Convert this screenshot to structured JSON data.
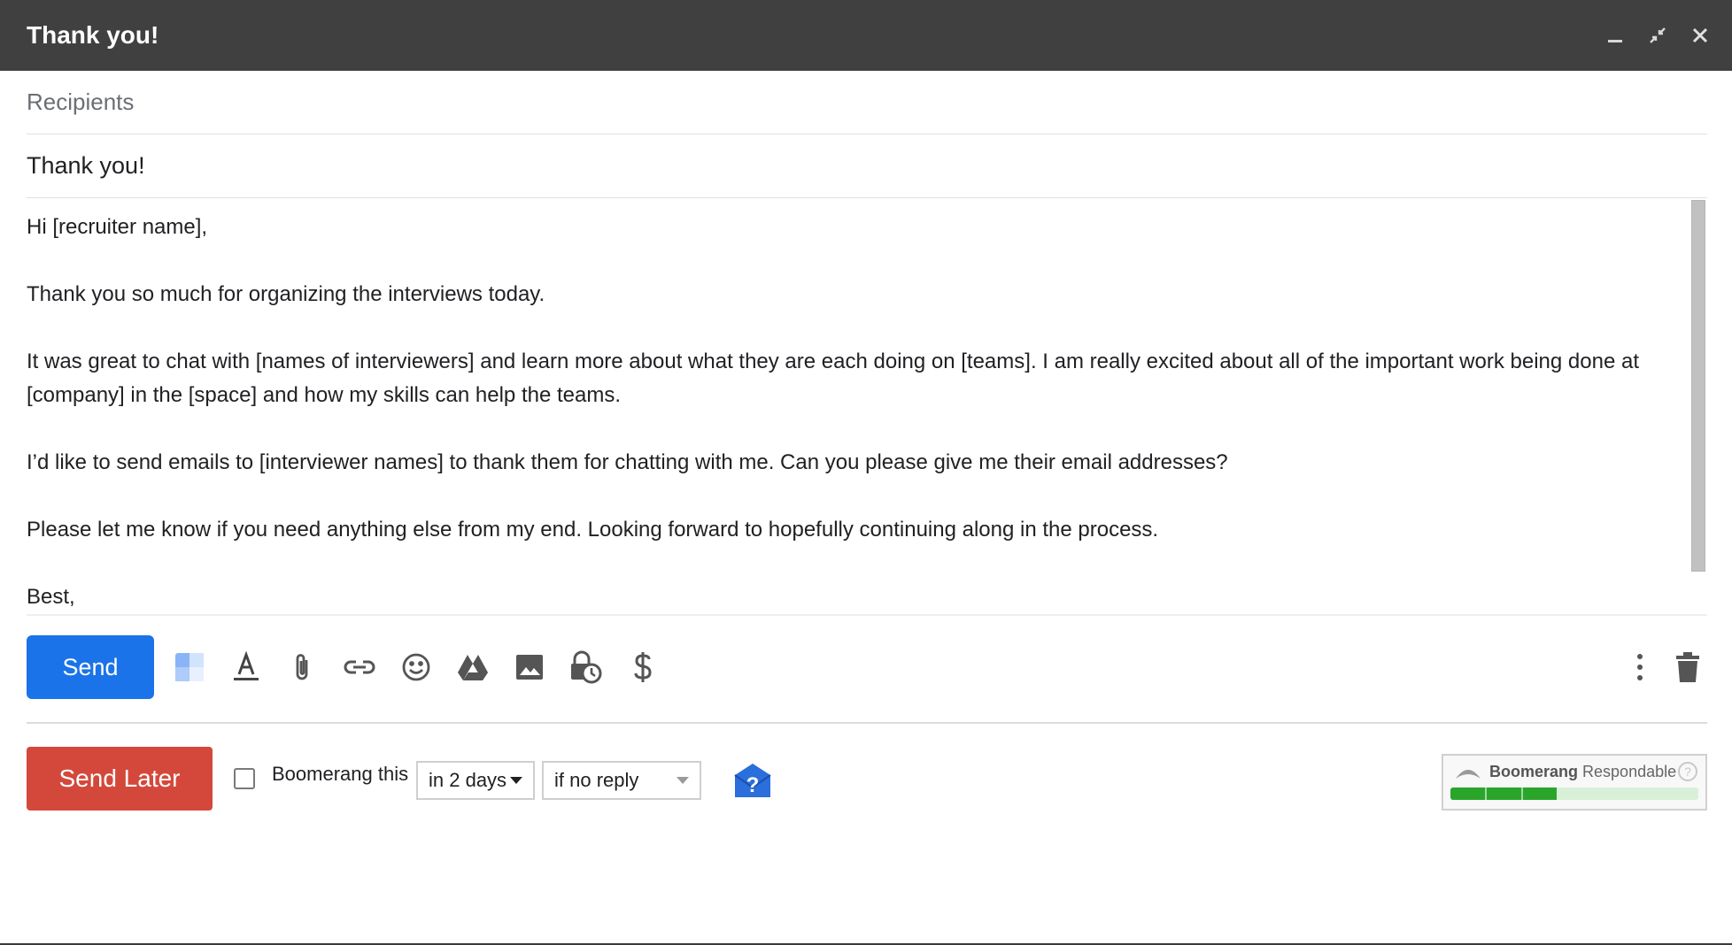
{
  "window": {
    "title": "Thank you!",
    "controls": [
      "minimize-icon",
      "exit-fullscreen-icon",
      "close-icon"
    ]
  },
  "recipients": {
    "placeholder": "Recipients"
  },
  "subject": {
    "value": "Thank you!"
  },
  "body": {
    "lines": [
      "Hi [recruiter name],",
      "Thank you so much for organizing the interviews today.",
      "It was great to chat with [names of interviewers] and learn more about what they are each doing on [teams]. I am really excited about all of the important work being done at [company] in the [space] and how my skills can help the teams.",
      "I’d like to send emails to [interviewer names] to thank them for chatting with me. Can you please give me their email addresses?",
      "Please let me know if you need anything else from my end. Looking forward to hopefully continuing along in the process.",
      "Best,"
    ]
  },
  "toolbar": {
    "send_label": "Send",
    "tools": [
      "template-icon",
      "text-format-icon",
      "attach-icon",
      "link-icon",
      "emoji-icon",
      "drive-icon",
      "photo-icon",
      "confidential-icon",
      "money-icon"
    ],
    "more_icon": "more-options-icon",
    "trash_icon": "trash-icon"
  },
  "boomerang": {
    "send_later_label": "Send Later",
    "checkbox_label": "Boomerang this",
    "when": "in 2 days",
    "condition": "if no reply",
    "respondable": {
      "brand": "Boomerang",
      "product": "Respondable",
      "score": 0.43
    }
  },
  "colors": {
    "titlebar": "#404040",
    "send": "#1a73e8",
    "send_later": "#d4483b",
    "respondable_fill": "#2aa52a"
  }
}
